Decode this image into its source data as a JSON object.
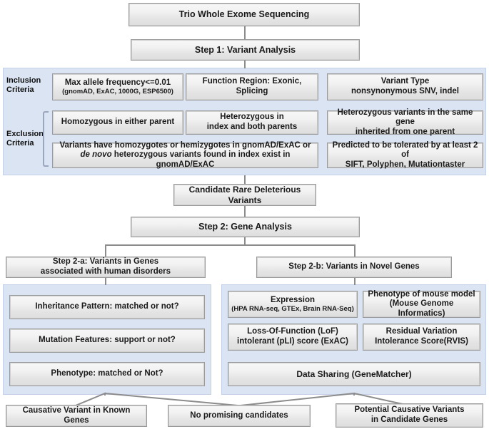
{
  "diagram": {
    "title": "Trio Whole Exome Sequencing workflow",
    "colors": {
      "panel_blue": "#dbe4f3",
      "node_border": "#9a9a9a",
      "connector": "#8c8c8c",
      "text": "#1a1a1a"
    }
  },
  "nodes": {
    "root": {
      "label": "Trio Whole Exome Sequencing"
    },
    "step1": {
      "label": "Step 1: Variant Analysis"
    },
    "inclusion_label": {
      "line1": "Inclusion",
      "line2": "Criteria"
    },
    "exclusion_label": {
      "line1": "Exclusion",
      "line2": "Criteria"
    },
    "inc1": {
      "line1": "Max allele frequency<=0.01",
      "line2": "(gnomAD, ExAC, 1000G, ESP6500)"
    },
    "inc2": {
      "line1": "Function Region: Exonic, Splicing",
      "line2": ""
    },
    "inc3": {
      "line1": "Variant Type",
      "line2": "nonsynonymous SNV, indel"
    },
    "exc1": {
      "line1": "Homozygous in either parent",
      "line2": ""
    },
    "exc2": {
      "line1": "Heterozygous in",
      "line2": "index and both parents"
    },
    "exc3": {
      "line1": "Heterozygous variants in the same gene",
      "line2": "inherited from one parent"
    },
    "exc4": {
      "line1": "Variants have homozygotes or hemizygotes in gnomAD/ExAC or",
      "line2_italic": "de novo",
      "line2_rest": " heterozygous variants found in index exist in gnomAD/ExAC"
    },
    "exc5": {
      "line1": "Predicted to be tolerated by at least 2 of",
      "line2": "SIFT, Polyphen, Mutationtaster"
    },
    "candidate": {
      "label": "Candidate Rare Deleterious Variants"
    },
    "step2": {
      "label": "Step 2: Gene Analysis"
    },
    "step2a": {
      "line1": "Step 2-a: Variants in Genes",
      "line2": "associated with human disorders"
    },
    "step2b": {
      "label": "Step 2-b: Variants in Novel Genes"
    },
    "a1": {
      "line1": "Inheritance Pattern: matched or not?",
      "line2": ""
    },
    "a2": {
      "line1": "Mutation Features: support or not?",
      "line2": ""
    },
    "a3": {
      "line1": "Phenotype: matched or Not?",
      "line2": ""
    },
    "b1": {
      "line1": "Expression",
      "line2": "(HPA RNA-seq, GTEx, Brain RNA-Seq)"
    },
    "b2": {
      "line1": "Phenotype of mouse model",
      "line2": "(Mouse Genome Informatics)"
    },
    "b3": {
      "line1": "Loss-Of-Function (LoF)",
      "line2": "intolerant (pLI) score (ExAC)"
    },
    "b4": {
      "line1": "Residual Variation",
      "line2": "Intolerance Score(RVIS)"
    },
    "b5": {
      "line1": "Data Sharing (GeneMatcher)",
      "line2": ""
    },
    "out1": {
      "line1": "Causative Variant in Known Genes",
      "line2": ""
    },
    "out2": {
      "line1": "No promising candidates",
      "line2": ""
    },
    "out3": {
      "line1": "Potential Causative Variants",
      "line2": "in Candidate Genes"
    }
  }
}
